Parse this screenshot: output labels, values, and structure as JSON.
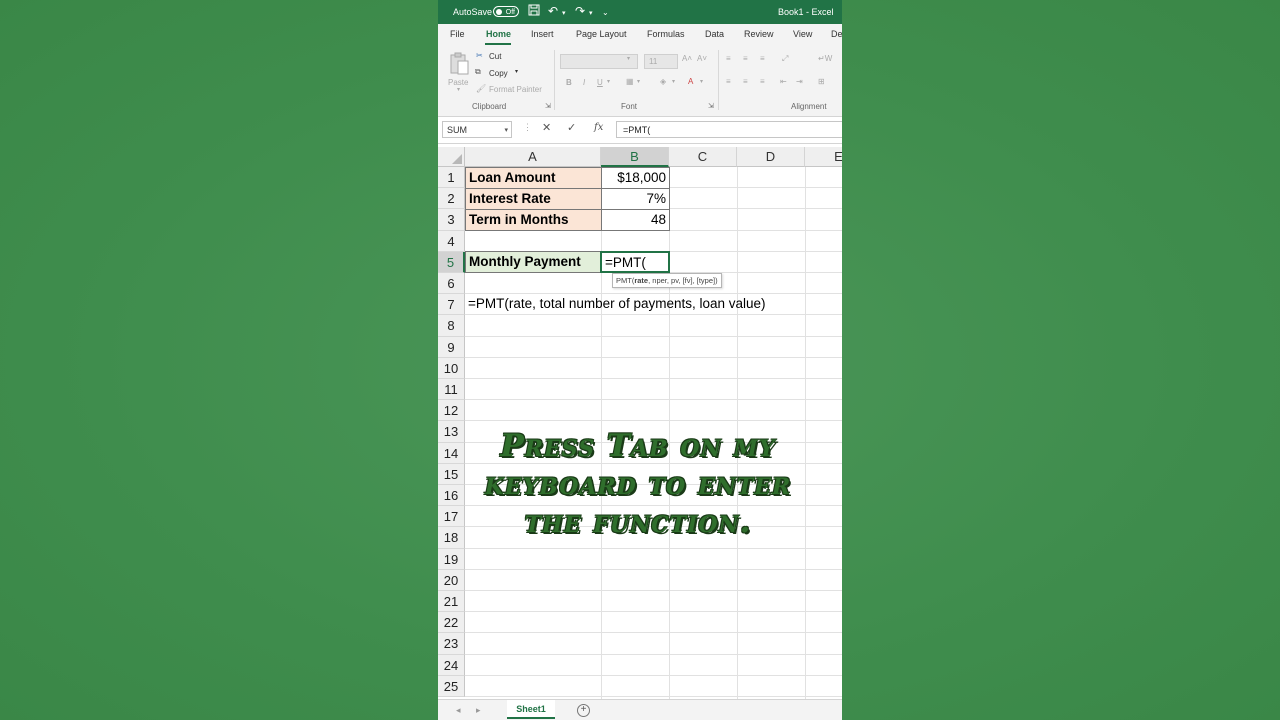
{
  "titlebar": {
    "autosave_label": "AutoSave",
    "autosave_state": "Off",
    "document_title": "Book1 - Excel",
    "icons": [
      "save-icon",
      "undo-icon",
      "redo-icon",
      "customize-icon"
    ]
  },
  "tabs": [
    "File",
    "Home",
    "Insert",
    "Page Layout",
    "Formulas",
    "Data",
    "Review",
    "View",
    "De"
  ],
  "active_tab": "Home",
  "ribbon": {
    "clipboard": {
      "paste": "Paste",
      "cut": "Cut",
      "copy": "Copy",
      "format_painter": "Format Painter",
      "group_label": "Clipboard"
    },
    "font": {
      "size": "11",
      "bold": "B",
      "italic": "I",
      "underline": "U",
      "group_label": "Font"
    },
    "alignment": {
      "group_label": "Alignment"
    }
  },
  "formula_bar": {
    "name_box": "SUM",
    "formula": "=PMT("
  },
  "columns": [
    "A",
    "B",
    "C",
    "D",
    "E"
  ],
  "selected_column": "B",
  "rows": [
    "1",
    "2",
    "3",
    "4",
    "5",
    "6",
    "7",
    "8",
    "9",
    "10",
    "11",
    "12",
    "13",
    "14",
    "15",
    "16",
    "17",
    "18",
    "19",
    "20",
    "21",
    "22",
    "23",
    "24",
    "25"
  ],
  "selected_row": "5",
  "cells": {
    "A1": "Loan Amount",
    "B1": "$18,000",
    "A2": "Interest Rate",
    "B2": "7%",
    "A3": "Term in Months",
    "B3": "48",
    "A5": "Monthly Payment",
    "B5": "=PMT(",
    "A7": "=PMT(rate, total number of payments, loan value)"
  },
  "tooltip": {
    "fn": "PMT(",
    "bold_arg": "rate",
    "rest": ", nper, pv, [fv], [type])"
  },
  "overlay_text": "Press Tab on my keyboard to enter the function.",
  "sheet_tabs": [
    "Sheet1"
  ],
  "colors": {
    "excel_green": "#217346",
    "background_green": "#3f8d4d",
    "label_fill": "#fbe5d6",
    "payment_fill": "#e2efda",
    "overlay_text": "#2f6e2c"
  }
}
